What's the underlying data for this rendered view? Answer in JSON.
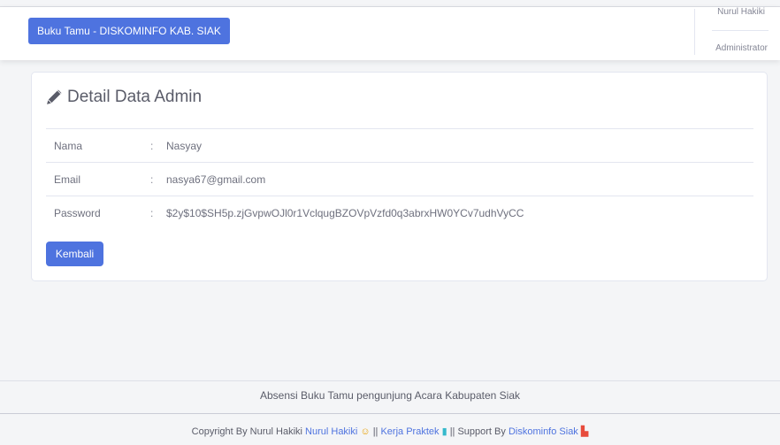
{
  "navbar": {
    "brand": "Buku Tamu - DISKOMINFO KAB. SIAK",
    "user_name": "Nurul Hakiki",
    "user_role": "Administrator"
  },
  "card": {
    "title": "Detail Data Admin",
    "rows": [
      {
        "label": "Nama",
        "sep": ":",
        "value": "Nasyay"
      },
      {
        "label": "Email",
        "sep": ":",
        "value": "nasya67@gmail.com"
      },
      {
        "label": "Password",
        "sep": ":",
        "value": "$2y$10$SH5p.zjGvpwOJl0r1VclqugBZOVpVzfd0q3abrxHW0YCv7udhVyCC"
      }
    ],
    "back_label": "Kembali"
  },
  "footer": {
    "title": "Absensi Buku Tamu pengunjung Acara Kabupaten Siak",
    "copy_prefix": "Copyright By Nurul Hakiki",
    "link1": "Nurul Hakiki",
    "sep1": "||",
    "link2": "Kerja Praktek",
    "sep2": "|| Support By",
    "link3": "Diskominfo Siak"
  }
}
